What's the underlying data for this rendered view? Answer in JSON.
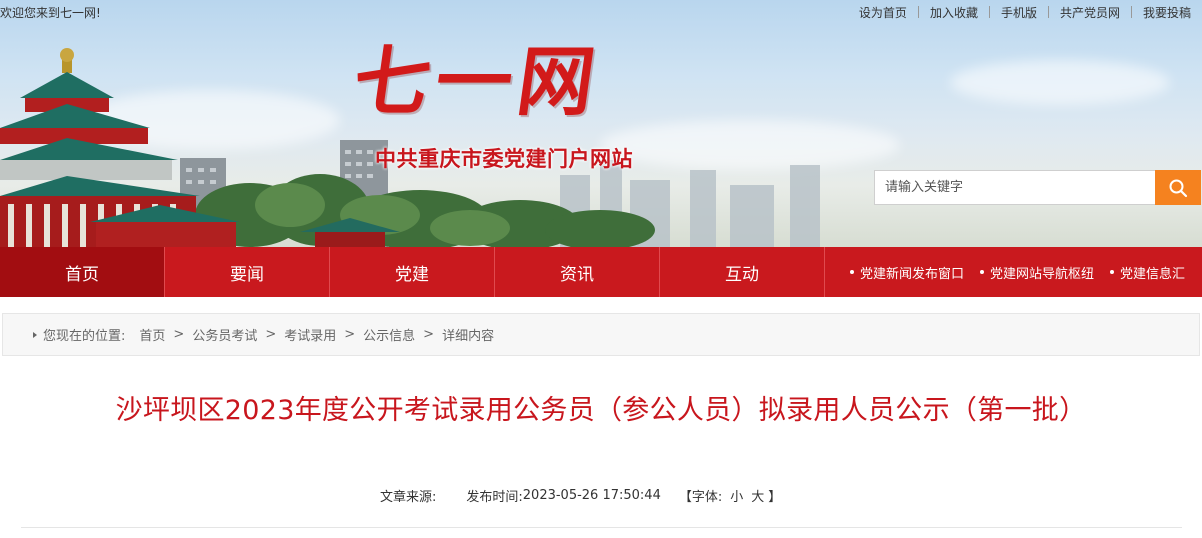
{
  "topbar": {
    "welcome": "欢迎您来到七一网!",
    "links": [
      "设为首页",
      "加入收藏",
      "手机版",
      "共产党员网",
      "我要投稿"
    ]
  },
  "logo": {
    "main": "七一网",
    "sub": "中共重庆市委党建门户网站"
  },
  "search": {
    "placeholder": "请输入关键字",
    "icon": "search-icon",
    "button_color": "#f5821f"
  },
  "nav": {
    "items": [
      "首页",
      "要闻",
      "党建",
      "资讯",
      "互动"
    ],
    "active": "首页",
    "links": [
      "党建新闻发布窗口",
      "党建网站导航枢纽",
      "党建信息汇"
    ],
    "color": "#c9191e"
  },
  "breadcrumb": {
    "label": "您现在的位置:",
    "items": [
      "首页",
      "公务员考试",
      "考试录用",
      "公示信息",
      "详细内容"
    ]
  },
  "article": {
    "title": "沙坪坝区2023年度公开考试录用公务员（参公人员）拟录用人员公示（第一批）",
    "source_label": "文章来源:",
    "time_label": "发布时间:",
    "time": "2023-05-26 17:50:44",
    "font_open": "【",
    "font_label": "字体:",
    "font_small": "小",
    "font_large": "大",
    "font_close": "】",
    "title_color": "#c8161d"
  }
}
